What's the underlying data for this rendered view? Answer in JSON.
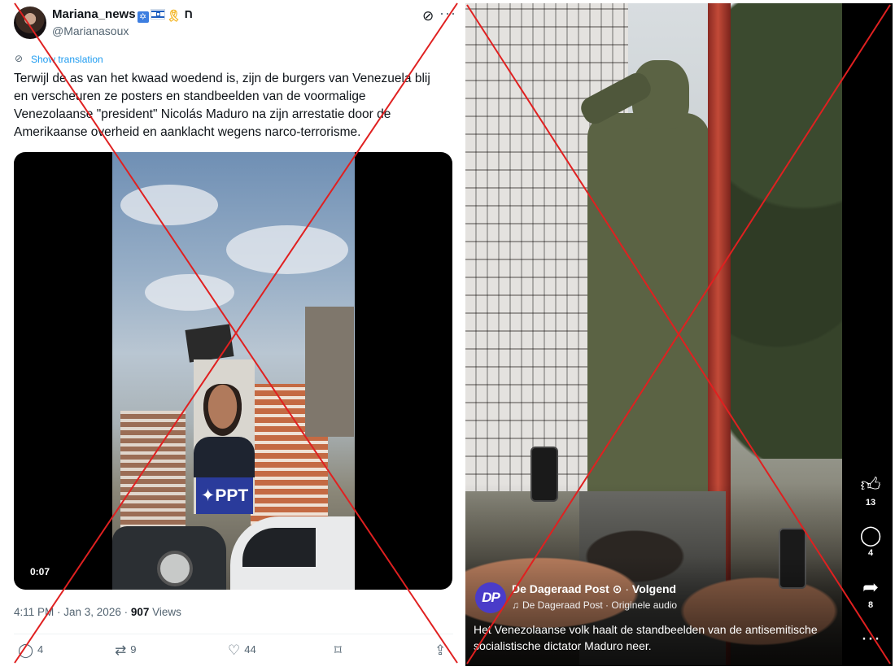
{
  "tweet": {
    "display_name": "Mariana_news",
    "name_suffix": "ח",
    "handle": "@Marianasoux",
    "show_translation": "Show translation",
    "text": "Terwijl de as van het kwaad woedend is, zijn de burgers van Venezuela blij en verscheuren ze posters en standbeelden van de voormalige Venezolaanse \"president\" Nicolás Maduro na zijn arrestatie door de Amerikaanse overheid en aanklacht wegens narco-terrorisme.",
    "video_time": "0:07",
    "poster_text": "PPT",
    "timestamp": "4:11 PM · Jan 3, 2026 · ",
    "views_count": "907",
    "views_label": " Views",
    "actions": {
      "replies": "4",
      "retweets": "9",
      "likes": "44"
    },
    "icons": {
      "avatar": "profile-photo",
      "badges": [
        "star-of-david-badge",
        "israel-flag",
        "yellow-ribbon"
      ],
      "grok": "grok-icon",
      "more": "more-icon",
      "reply": "reply-icon",
      "retweet": "retweet-icon",
      "like": "heart-icon",
      "bookmark": "bookmark-icon",
      "share": "share-icon"
    }
  },
  "reel": {
    "page_logo": "DP",
    "page_name": "De Dageraad Post",
    "follow_label": "Volgend",
    "audio": "De Dageraad Post · Originele audio",
    "caption": "Het Venezolaanse volk haalt de standbeelden van de antisemitische socialistische dictator Maduro neer.",
    "likes": "13",
    "comments": "4",
    "shares": "8",
    "icons": {
      "like": "thumbs-up-icon",
      "comment": "comment-icon",
      "share": "share-arrow-icon",
      "more": "more-icon",
      "audio": "music-note-icon",
      "globe": "globe-icon"
    }
  },
  "colors": {
    "link_blue": "#1d9bf0",
    "muted_text": "#536471",
    "cross_red": "#e02020",
    "page_logo_bg": "#4a3cc9"
  }
}
